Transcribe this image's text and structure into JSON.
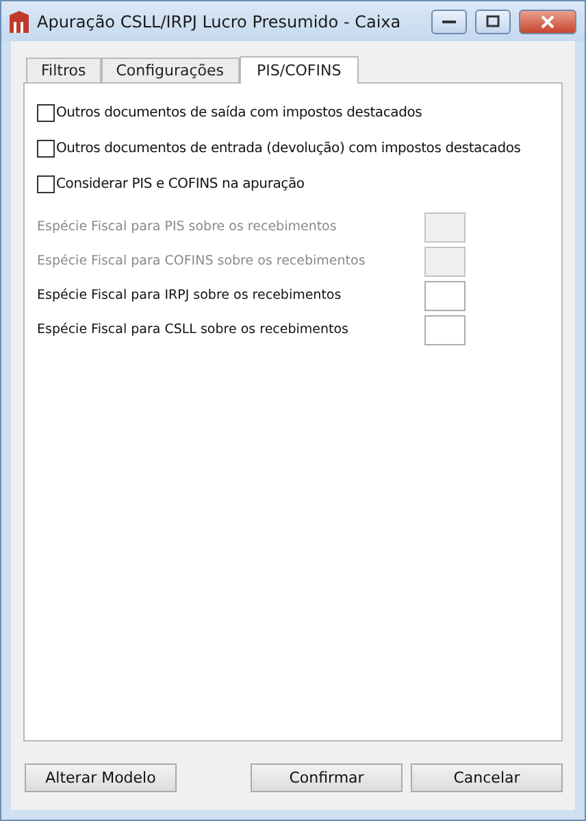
{
  "window": {
    "title": "Apuração CSLL/IRPJ Lucro Presumido - Caixa"
  },
  "tabs": [
    {
      "label": "Filtros",
      "selected": false
    },
    {
      "label": "Configurações",
      "selected": false
    },
    {
      "label": "PIS/COFINS",
      "selected": true
    }
  ],
  "checkboxes": [
    {
      "label": "Outros documentos de saída com impostos destacados",
      "checked": false
    },
    {
      "label": "Outros documentos de entrada (devolução) com impostos destacados",
      "checked": false
    },
    {
      "label": "Considerar PIS e COFINS na apuração",
      "checked": false
    }
  ],
  "fields": [
    {
      "label": "Espécie Fiscal para PIS sobre os recebimentos",
      "disabled": true
    },
    {
      "label": "Espécie Fiscal para COFINS sobre os recebimentos",
      "disabled": true
    },
    {
      "label": "Espécie Fiscal para IRPJ sobre os recebimentos",
      "disabled": false
    },
    {
      "label": "Espécie Fiscal para CSLL sobre os recebimentos",
      "disabled": false
    }
  ],
  "buttons": [
    {
      "label": "Alterar Modelo",
      "kind": "left"
    },
    {
      "label": "Confirmar",
      "kind": "right"
    },
    {
      "label": "Cancelar",
      "kind": "right"
    }
  ]
}
